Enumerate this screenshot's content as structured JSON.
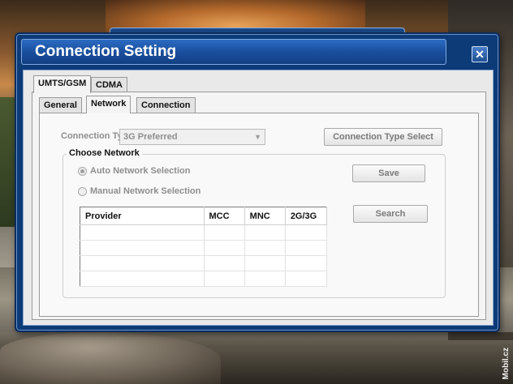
{
  "window": {
    "title": "Connection Setting",
    "close_glyph": "✕"
  },
  "top_tabs": [
    {
      "label": "UMTS/GSM",
      "active": true
    },
    {
      "label": "CDMA",
      "active": false
    }
  ],
  "sub_tabs": [
    {
      "label": "General",
      "active": false
    },
    {
      "label": "Network",
      "active": true
    },
    {
      "label": "Connection",
      "active": false
    }
  ],
  "connection_type": {
    "label": "Connection Type",
    "value": "3G Preferred",
    "select_button": "Connection Type Select"
  },
  "choose_network": {
    "title": "Choose Network",
    "auto_label": "Auto Network Selection",
    "manual_label": "Manual Network Selection",
    "selected": "auto",
    "save_button": "Save",
    "search_button": "Search"
  },
  "provider_table": {
    "columns": [
      "Provider",
      "MCC",
      "MNC",
      "2G/3G"
    ],
    "rows": [
      [
        "",
        "",
        "",
        ""
      ],
      [
        "",
        "",
        "",
        ""
      ],
      [
        "",
        "",
        "",
        ""
      ],
      [
        "",
        "",
        "",
        ""
      ]
    ]
  },
  "watermark": "Mobil.cz",
  "colors": {
    "title_bar": "#1a4f9e",
    "dialog_frame": "#0d3b78",
    "disabled_text": "#8e8e8e"
  }
}
